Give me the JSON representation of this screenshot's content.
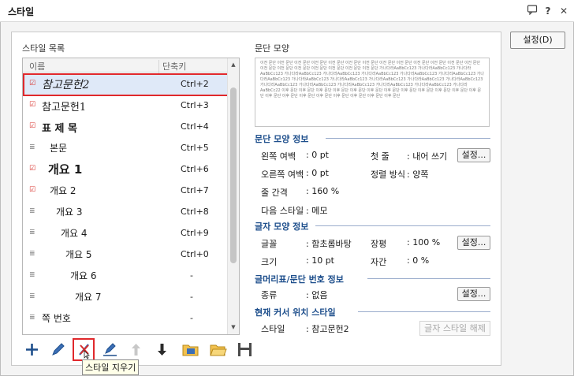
{
  "window": {
    "title": "스타일"
  },
  "titlebar_icons": {
    "comment": "comment-icon",
    "help": "?",
    "close": "✕"
  },
  "settings_button": "설정(D)",
  "style_list": {
    "label": "스타일 목록",
    "columns": [
      "이름",
      "단축키"
    ],
    "items": [
      {
        "name": "참고문헌2",
        "shortcut": "Ctrl+2",
        "type": "para",
        "selected": true
      },
      {
        "name": "참고문헌1",
        "shortcut": "Ctrl+3",
        "type": "para"
      },
      {
        "name": "표 제 목",
        "shortcut": "Ctrl+4",
        "type": "para"
      },
      {
        "name": "본문",
        "shortcut": "Ctrl+5",
        "type": "char"
      },
      {
        "name": "개요 1",
        "shortcut": "Ctrl+6",
        "type": "para"
      },
      {
        "name": "개요 2",
        "shortcut": "Ctrl+7",
        "type": "para"
      },
      {
        "name": "개요 3",
        "shortcut": "Ctrl+8",
        "type": "char"
      },
      {
        "name": "개요 4",
        "shortcut": "Ctrl+9",
        "type": "char"
      },
      {
        "name": "개요 5",
        "shortcut": "Ctrl+0",
        "type": "char"
      },
      {
        "name": "개요 6",
        "shortcut": "-",
        "type": "char"
      },
      {
        "name": "개요 7",
        "shortcut": "-",
        "type": "char"
      },
      {
        "name": "쪽 번호",
        "shortcut": "-",
        "type": "char"
      }
    ]
  },
  "preview": {
    "label": "문단 모양",
    "text": "이전 문단 이전 문단 이전 문단 이전 문단 이전 문단 이전 문단 이전 문단 이전 문단 이전 문단 이전 문단 이전 문단 이전 문단 이전 문단 이전 문단 이전 문단 이전 문단 이전 문단 이전 문단 이전 문단 이전 문단 가나다라AaBbCc123 가나다라AaBbCc123 가나다라AaBbCc123 가나다라AaBbCc123 가나다라AaBbCc123 가나다라AaBbCc123 가나다라AaBbCc123 가나다라AaBbCc123 가나다라AaBbCc123 가나다라AaBbCc123 가나다라AaBbCc123 가나다라AaBbCc123 가나다라AaBbCc123 가나다라AaBbCc123 가나다라AaBbCc123 가나다라AaBbCc123 가나다라AaBbCc123 가나다라AaBbCc123 가나다라AaBbCc123 가나다라AaBbCc22 이후 문단 이후 문단 이후 문단 이후 문단 이후 문단 이후 문단 이후 문단 이후 문단 이후 문단 이후 문단 이후 문단 이후 문단 이후 문단 이후 문단 이후 문단 이후 문단 이후 문단 이후 문단 이후 문단 이후 문단"
  },
  "para_info": {
    "title": "문단 모양 정보",
    "left_margin_label": "왼쪽 여백",
    "left_margin_value": ": 0 pt",
    "first_line_label": "첫 줄",
    "first_line_value": ": 내어 쓰기",
    "right_margin_label": "오른쪽 여백",
    "right_margin_value": ": 0 pt",
    "align_label": "정렬 방식",
    "align_value": ": 양쪽",
    "line_spacing_label": "줄 간격",
    "line_spacing_value": ": 160 %",
    "next_style_label": "다음 스타일",
    "next_style_value": ": 메모",
    "button": "설정..."
  },
  "char_info": {
    "title": "글자 모양 정보",
    "font_label": "글꼴",
    "font_value": ": 함초롬바탕",
    "ratio_label": "장평",
    "ratio_value": ": 100 %",
    "size_label": "크기",
    "size_value": ": 10 pt",
    "spacing_label": "자간",
    "spacing_value": ": 0 %",
    "button": "설정..."
  },
  "bullet_info": {
    "title": "글머리표/문단 번호 정보",
    "kind_label": "종류",
    "kind_value": ": 없음",
    "button": "설정..."
  },
  "cursor_info": {
    "title": "현재 커서 위치 스타일",
    "style_label": "스타일",
    "style_value": ": 참고문헌2",
    "clear_button": "글자 스타일 해제"
  },
  "toolbar": {
    "buttons": [
      "add-style",
      "edit-style",
      "delete-style",
      "replace-style",
      "move-up",
      "move-down",
      "import-style",
      "export-style",
      "save-style"
    ],
    "tooltip": "스타일 지우기"
  },
  "colors": {
    "accent": "#1e4f8c",
    "highlight": "#e0282c",
    "selection": "#dfe9f8"
  }
}
